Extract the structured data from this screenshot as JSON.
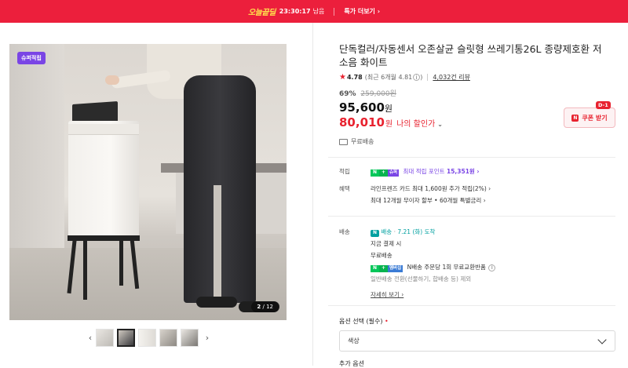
{
  "banner": {
    "brand_a": "오늘",
    "brand_b": "끝딜",
    "timer": "23:30:17",
    "timer_suffix": "남음",
    "more_label": "특가 더보기 ›"
  },
  "gallery": {
    "badge": "슈퍼적립",
    "counter_current": "2",
    "counter_total": "/ 12",
    "prev_glyph": "‹",
    "next_glyph": "›",
    "thumb_count": 5,
    "active_thumb": 2
  },
  "product": {
    "title": "단독컬러/자동센서 오존살균 슬릿형 쓰레기통26L 종량제호환 저소음 화이트",
    "rating": "4.78",
    "rating_recent": "(최근 6개월 4.81",
    "rating_close": ")",
    "review_count": "4,032건 리뷰",
    "discount_rate": "69%",
    "original_price": "259,000원",
    "price": "95,600",
    "price_unit": "원",
    "my_price": "80,010",
    "my_price_unit": "원",
    "my_price_label": "나의 할인가",
    "free_shipping": "무료배송",
    "coupon_label": "쿠폰 받기",
    "coupon_dday": "D-1"
  },
  "benefits": {
    "point_key": "적립",
    "point_text": "최대 적립 포인트",
    "point_value": "15,351원 ›",
    "benefit_key": "혜택",
    "benefit_line1": "라인프렌즈 카드 최대 1,600원 추가 적립(2%) ›",
    "benefit_line2": "최대 12개월 무이자 할부 • 60개월 특별금리 ›"
  },
  "delivery": {
    "key": "배송",
    "arrival_badge": "배송",
    "arrival": "7.21 (화) 도착",
    "payment": "지금 결제 시",
    "shipping": "무료배송",
    "n_delivery": "N배송 주문당 1회 무료교환반품",
    "normal": "일반배송 전환(선물하기, 합배송 등) 제외",
    "detail_link": "자세히 보기 ›"
  },
  "options": {
    "label": "옵션 선택 (필수)",
    "required_mark": "•",
    "select_value": "색상",
    "additional_label": "추가 옵션"
  },
  "colors": {
    "accent": "#ec1f3c",
    "sale_red": "#e8222f",
    "naver_green": "#03c75a",
    "point_purple": "#7a45e5"
  }
}
